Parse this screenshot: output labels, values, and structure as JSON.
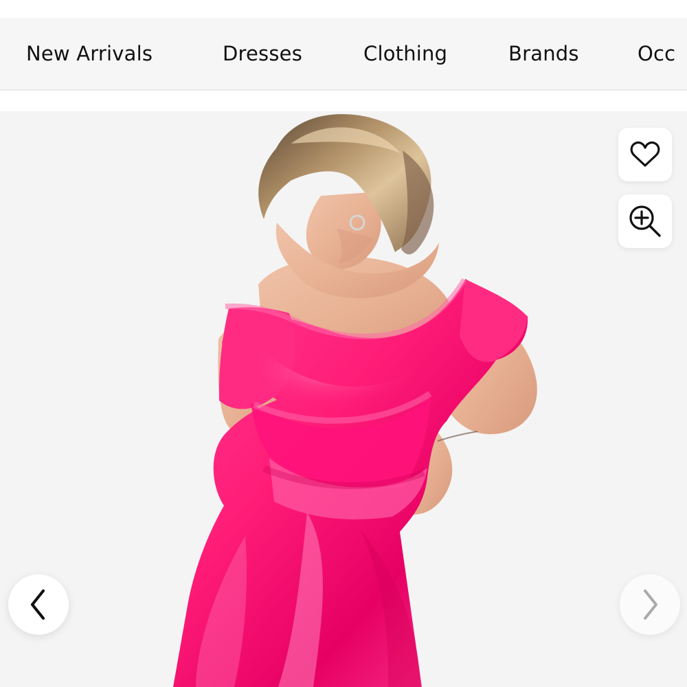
{
  "nav": {
    "items": [
      {
        "label": "New Arrivals"
      },
      {
        "label": "Dresses"
      },
      {
        "label": "Clothing"
      },
      {
        "label": "Brands"
      },
      {
        "label": "Occ"
      }
    ]
  },
  "product": {
    "dress_color": "#ff1d78"
  },
  "actions": {
    "favorite_icon": "heart-icon",
    "zoom_icon": "zoom-in-icon"
  },
  "carousel": {
    "previous_icon": "chevron-left-icon",
    "next_icon": "chevron-right-icon"
  }
}
